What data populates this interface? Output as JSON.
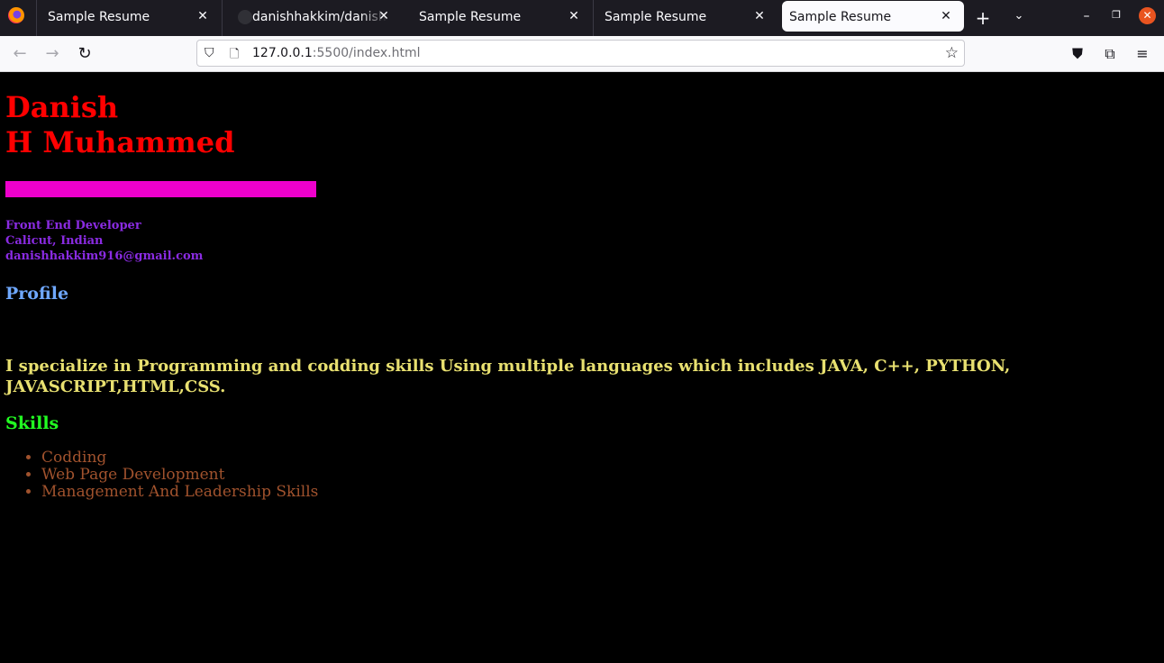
{
  "browser": {
    "tabs": [
      {
        "title": "Sample Resume",
        "active": false
      },
      {
        "title": "danishhakkim/danishhakkim",
        "active": false
      },
      {
        "title": "Sample Resume",
        "active": false
      },
      {
        "title": "Sample Resume",
        "active": false
      },
      {
        "title": "Sample Resume",
        "active": true
      }
    ],
    "url_host": "127.0.0.1",
    "url_rest": ":5500/index.html"
  },
  "resume": {
    "name_line1": "Danish",
    "name_line2": "H Muhammed",
    "accent_bar_color": "#ee00cc",
    "role": "Front End Developer",
    "location": "Calicut, Indian",
    "email": "danishhakkim916@gmail.com",
    "profile_heading": "Profile",
    "profile_text": "I specialize in Programming and codding skills Using multiple languages which includes JAVA, C++, PYTHON, JAVASCRIPT,HTML,CSS.",
    "skills_heading": "Skills",
    "skills": [
      "Codding",
      "Web Page Development",
      "Management And Leadership Skills"
    ]
  },
  "colors": {
    "name": "#ff0000",
    "info": "#8a2be2",
    "profile_heading": "#6fa8ff",
    "profile_text": "#e8e070",
    "skills_heading": "#22ff22",
    "skills_items": "#a0522d"
  }
}
